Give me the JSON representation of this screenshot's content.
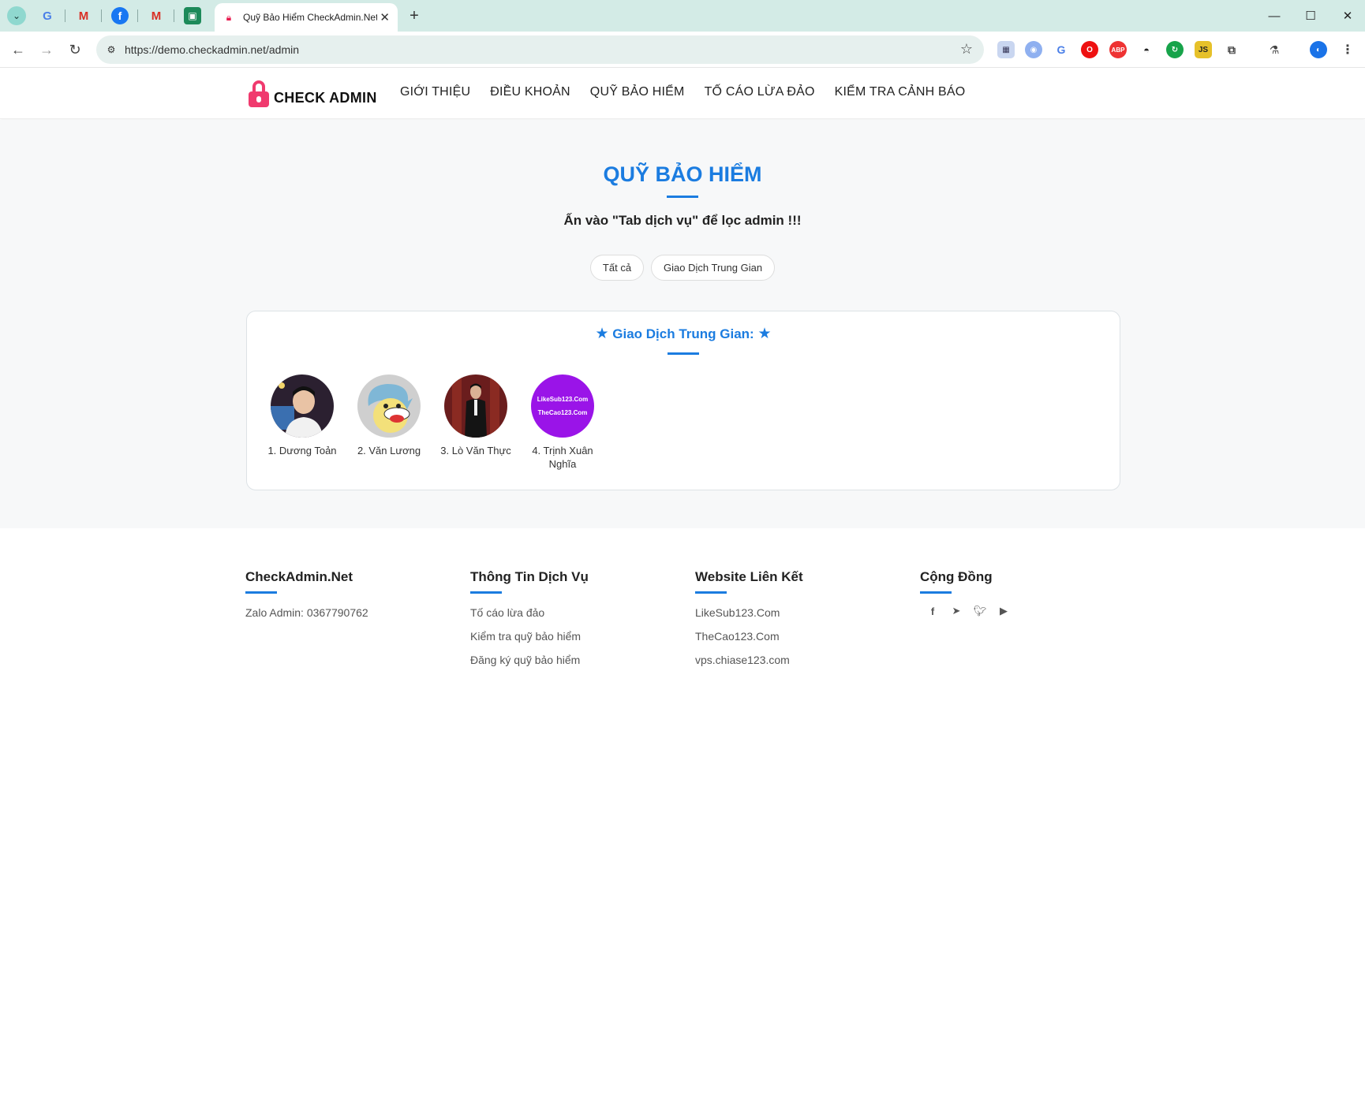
{
  "browser": {
    "tab_title": "Quỹ Bảo Hiểm CheckAdmin.Net",
    "url": "https://demo.checkadmin.net/admin",
    "pinned_tabs": [
      "translate-icon",
      "gmail-icon",
      "facebook-icon",
      "gmail-icon",
      "app-icon"
    ]
  },
  "header": {
    "logo_text": "CHECK ADMIN",
    "menu": [
      "GIỚI THIỆU",
      "ĐIỀU KHOẢN",
      "QUỸ BẢO HIỂM",
      "TỐ CÁO LỪA ĐẢO",
      "KIỂM TRA CẢNH BÁO"
    ]
  },
  "main": {
    "title": "QUỸ BẢO HIỂM",
    "subtitle": "Ấn vào \"Tab dịch vụ\" để lọc admin !!!",
    "filters": [
      "Tất cả",
      "Giao Dịch Trung Gian"
    ],
    "section_title": "Giao Dịch Trung Gian:",
    "admins": [
      {
        "name": "1. Dương Toản"
      },
      {
        "name": "2. Văn Lương"
      },
      {
        "name": "3. Lò Văn Thực"
      },
      {
        "name": "4. Trịnh Xuân Nghĩa",
        "avatar_text": [
          "LikeSub123.Com",
          "TheCao123.Com"
        ]
      }
    ]
  },
  "footer": {
    "col1": {
      "title": "CheckAdmin.Net",
      "items": [
        "Zalo Admin: 0367790762"
      ]
    },
    "col2": {
      "title": "Thông Tin Dịch Vụ",
      "items": [
        "Tố cáo lừa đảo",
        "Kiểm tra quỹ bảo hiểm",
        "Đăng ký quỹ bảo hiểm"
      ]
    },
    "col3": {
      "title": "Website Liên Kết",
      "items": [
        "LikeSub123.Com",
        "TheCao123.Com",
        "vps.chiase123.com"
      ]
    },
    "col4": {
      "title": "Cộng Đồng",
      "social": [
        "facebook-icon",
        "telegram-icon",
        "twitter-icon",
        "youtube-icon"
      ]
    }
  },
  "colors": {
    "accent": "#1b7ce0",
    "logo": "#f03a6e",
    "browser_frame": "#d3ebe6"
  }
}
